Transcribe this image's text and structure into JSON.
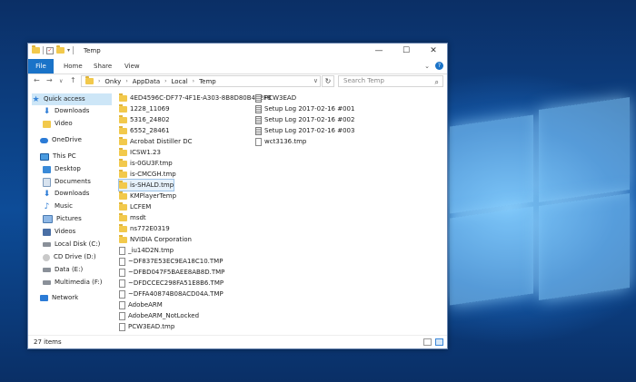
{
  "window": {
    "title": "Temp",
    "controls": {
      "minimize": "—",
      "maximize": "☐",
      "close": "✕"
    }
  },
  "ribbon": {
    "tabs": [
      "File",
      "Home",
      "Share",
      "View"
    ],
    "expand": "⌄",
    "help": "?"
  },
  "address": {
    "crumbs": [
      "Onky",
      "AppData",
      "Local",
      "Temp"
    ],
    "search_placeholder": "Search Temp"
  },
  "nav": {
    "items": [
      {
        "label": "Quick access",
        "icon": "star-icon"
      },
      {
        "label": "Downloads",
        "icon": "download-icon"
      },
      {
        "label": "Video",
        "icon": "folder-icon"
      },
      {
        "label": "OneDrive",
        "icon": "cloud-icon"
      },
      {
        "label": "This PC",
        "icon": "computer-icon"
      },
      {
        "label": "Desktop",
        "icon": "desktop-icon"
      },
      {
        "label": "Documents",
        "icon": "documents-icon"
      },
      {
        "label": "Downloads",
        "icon": "download-icon"
      },
      {
        "label": "Music",
        "icon": "music-icon"
      },
      {
        "label": "Pictures",
        "icon": "pictures-icon"
      },
      {
        "label": "Videos",
        "icon": "videos-icon"
      },
      {
        "label": "Local Disk (C:)",
        "icon": "disk-icon"
      },
      {
        "label": "CD Drive (D:)",
        "icon": "cd-icon"
      },
      {
        "label": "Data (E:)",
        "icon": "disk-icon"
      },
      {
        "label": "Multimedia (F:)",
        "icon": "disk-icon"
      },
      {
        "label": "Network",
        "icon": "network-icon"
      }
    ]
  },
  "files": {
    "col1": [
      {
        "name": "4ED4596C-DF77-4F1E-A303-8B8D80B452F8",
        "type": "folder"
      },
      {
        "name": "1228_11069",
        "type": "folder"
      },
      {
        "name": "5316_24802",
        "type": "folder"
      },
      {
        "name": "6552_28461",
        "type": "folder"
      },
      {
        "name": "Acrobat Distiller DC",
        "type": "folder"
      },
      {
        "name": "ICSW1.23",
        "type": "folder"
      },
      {
        "name": "is-0GU3F.tmp",
        "type": "folder"
      },
      {
        "name": "is-CMCGH.tmp",
        "type": "folder"
      },
      {
        "name": "is-SHALD.tmp",
        "type": "folder"
      },
      {
        "name": "KMPlayerTemp",
        "type": "folder"
      },
      {
        "name": "LCFEM",
        "type": "folder"
      },
      {
        "name": "msdt",
        "type": "folder"
      },
      {
        "name": "ns772E0319",
        "type": "folder"
      },
      {
        "name": "NVIDIA Corporation",
        "type": "folder"
      },
      {
        "name": "_iu14D2N.tmp",
        "type": "file"
      },
      {
        "name": "~DF837E53EC9EA18C10.TMP",
        "type": "file"
      },
      {
        "name": "~DFBD047F5BAEE8AB8D.TMP",
        "type": "file"
      },
      {
        "name": "~DFDCCEC298FA51E8B6.TMP",
        "type": "file"
      },
      {
        "name": "~DFFA40874B08ACD04A.TMP",
        "type": "file"
      },
      {
        "name": "AdobeARM",
        "type": "file"
      },
      {
        "name": "AdobeARM_NotLocked",
        "type": "file"
      },
      {
        "name": "PCW3EAD.tmp",
        "type": "file"
      }
    ],
    "col2": [
      {
        "name": "PCW3EAD",
        "type": "log"
      },
      {
        "name": "Setup Log 2017-02-16 #001",
        "type": "log"
      },
      {
        "name": "Setup Log 2017-02-16 #002",
        "type": "log"
      },
      {
        "name": "Setup Log 2017-02-16 #003",
        "type": "log"
      },
      {
        "name": "wct3136.tmp",
        "type": "file"
      }
    ]
  },
  "status": {
    "count": "27 items"
  }
}
